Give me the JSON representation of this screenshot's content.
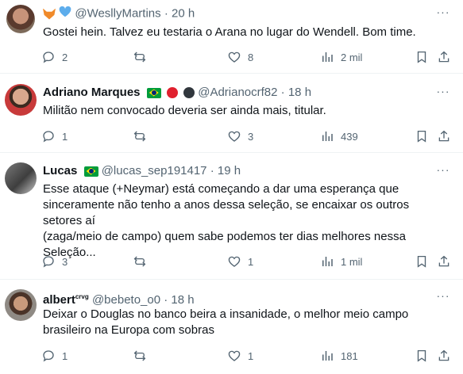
{
  "posts": [
    {
      "name": "",
      "emoji_badges": [
        "fox-emoji",
        "blue-heart-emoji"
      ],
      "handle": "@WesllyMartins",
      "sep": "·",
      "time": "20 h",
      "text": "Gostei hein. Talvez eu testaria o Arana no lugar do Wendell.  Bom time.",
      "replies": "2",
      "reposts": "",
      "likes": "8",
      "views": "2 mil"
    },
    {
      "name": "Adriano Marques",
      "badges": [
        "brazil-flag",
        "red-circle",
        "black-circle"
      ],
      "handle": "@Adrianocrf82",
      "sep": "·",
      "time": "18 h",
      "text": "Militão nem convocado deveria ser ainda mais, titular.",
      "replies": "1",
      "reposts": "",
      "likes": "3",
      "views": "439"
    },
    {
      "name": "Lucas",
      "badges": [
        "brazil-flag"
      ],
      "handle": "@lucas_sep191417",
      "sep": "·",
      "time": "19 h",
      "text_lines": [
        "Esse ataque (+Neymar) está começando a dar uma esperança que",
        "sinceramente não tenho a anos dessa seleção, se encaixar os outros setores aí",
        "(zaga/meio de campo) quem sabe podemos ter dias melhores nessa",
        "Seleção..."
      ],
      "replies": "3",
      "reposts": "",
      "likes": "1",
      "views": "1 mil"
    },
    {
      "name": "albert",
      "name_sup": "crvg",
      "handle": "@bebeto_o0",
      "sep": "·",
      "time": "18 h",
      "text_lines": [
        "Deixar o Douglas no banco beira a insanidade, o melhor meio campo",
        "brasileiro na Europa com sobras"
      ],
      "replies": "1",
      "reposts": "",
      "likes": "1",
      "views": "181"
    }
  ],
  "more_label": "···",
  "colors": {
    "text": "#0f1419",
    "muted": "#536471",
    "divider": "#eff3f4",
    "red": "#e0202e"
  }
}
